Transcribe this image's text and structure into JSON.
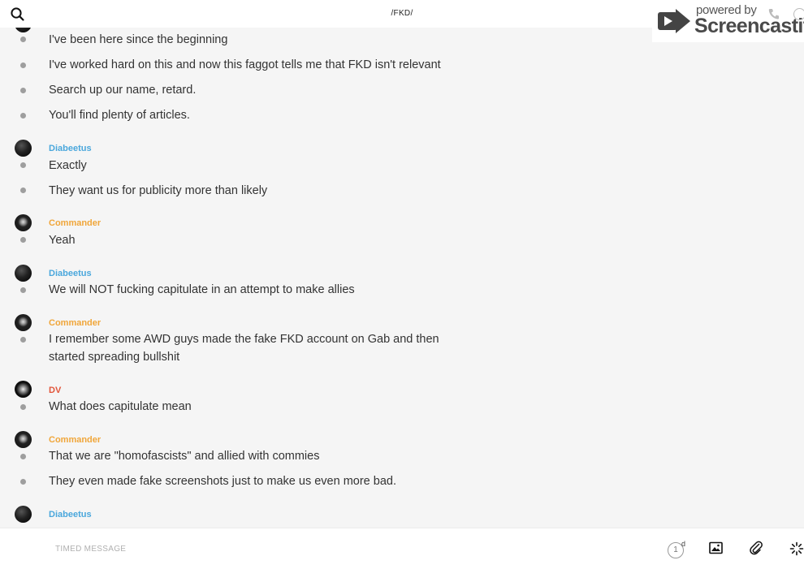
{
  "header": {
    "title": "/FKD/",
    "search_icon": "search-icon"
  },
  "watermark": {
    "powered_by": "powered by",
    "brand": "Screencastify"
  },
  "colors": {
    "diabeetus": "#4aa7dc",
    "commander": "#f0a63a",
    "dv": "#e2553a"
  },
  "messages": [
    {
      "text": "I've been here since the beginning"
    },
    {
      "text": "I've worked hard on this and now this faggot tells me that FKD isn't relevant"
    },
    {
      "text": "Search up our name, retard."
    },
    {
      "text": "You'll find plenty of articles."
    }
  ],
  "groups": [
    {
      "author": "Diabeetus",
      "messages": [
        "Exactly",
        "They want us for publicity more than likely"
      ]
    },
    {
      "author": "Commander",
      "messages": [
        "Yeah"
      ]
    },
    {
      "author": "Diabeetus",
      "messages": [
        "We will NOT fucking capitulate in an attempt to make allies"
      ]
    },
    {
      "author": "Commander",
      "messages": [
        "I remember some AWD guys made the fake FKD account on Gab and then started spreading bullshit"
      ]
    },
    {
      "author": "DV",
      "messages": [
        "What does capitulate mean"
      ]
    },
    {
      "author": "Commander",
      "messages": [
        "That we are \"homofascists\" and allied with commies",
        "They even made fake screenshots just to make us even more bad."
      ]
    },
    {
      "author": "Diabeetus",
      "messages": []
    }
  ],
  "composer": {
    "placeholder": "TIMED MESSAGE",
    "timer_value": "1",
    "timer_unit": "d",
    "icons": [
      "image-icon",
      "paperclip-icon",
      "spinner-icon"
    ]
  }
}
